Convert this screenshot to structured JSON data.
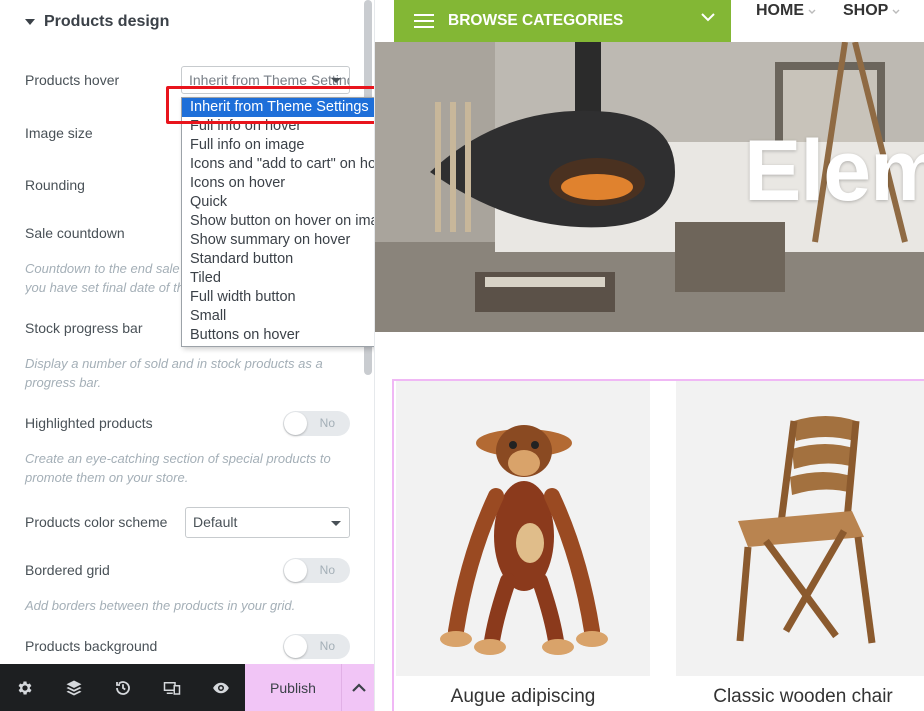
{
  "panel": {
    "section_title": "Products design",
    "controls": {
      "products_hover": {
        "label": "Products hover",
        "value": "Inherit from Theme Settings"
      },
      "image_size": {
        "label": "Image size"
      },
      "rounding": {
        "label": "Rounding"
      },
      "sale_countdown": {
        "label": "Sale countdown",
        "description": "Countdown to the end sale date will be shown. Be sure you have set final date of the product sale price."
      },
      "stock_progress_bar": {
        "label": "Stock progress bar",
        "description": "Display a number of sold and in stock products as a progress bar."
      },
      "highlighted_products": {
        "label": "Highlighted products",
        "toggle": "No",
        "description": "Create an eye-catching section of special products to promote them on your store."
      },
      "products_color_scheme": {
        "label": "Products color scheme",
        "value": "Default"
      },
      "bordered_grid": {
        "label": "Bordered grid",
        "toggle": "No",
        "description": "Add borders between the products in your grid."
      },
      "products_background": {
        "label": "Products background",
        "toggle": "No"
      }
    },
    "dropdown_options": [
      "Inherit from Theme Settings",
      "Full info on hover",
      "Full info on image",
      "Icons and \"add to cart\" on hover",
      "Icons on hover",
      "Quick",
      "Show button on hover on image",
      "Show summary on hover",
      "Standard button",
      "Tiled",
      "Full width button",
      "Small",
      "Buttons on hover"
    ],
    "footer": {
      "tools": [
        "settings-icon",
        "layers-icon",
        "history-icon",
        "responsive-icon",
        "preview-eye-icon"
      ],
      "publish_label": "Publish"
    }
  },
  "preview": {
    "browse_label": "BROWSE CATEGORIES",
    "nav": [
      "HOME",
      "SHOP"
    ],
    "hero_title": "Elem",
    "products": [
      {
        "name": "Augue adipiscing"
      },
      {
        "name": "Classic wooden chair"
      }
    ]
  },
  "colors": {
    "browse_green": "#83b735",
    "publish_pink": "#f1c5f6",
    "selected_blue": "#1e6fd9",
    "highlight_red": "#e8141c",
    "grid_border": "#f0b8f5"
  }
}
